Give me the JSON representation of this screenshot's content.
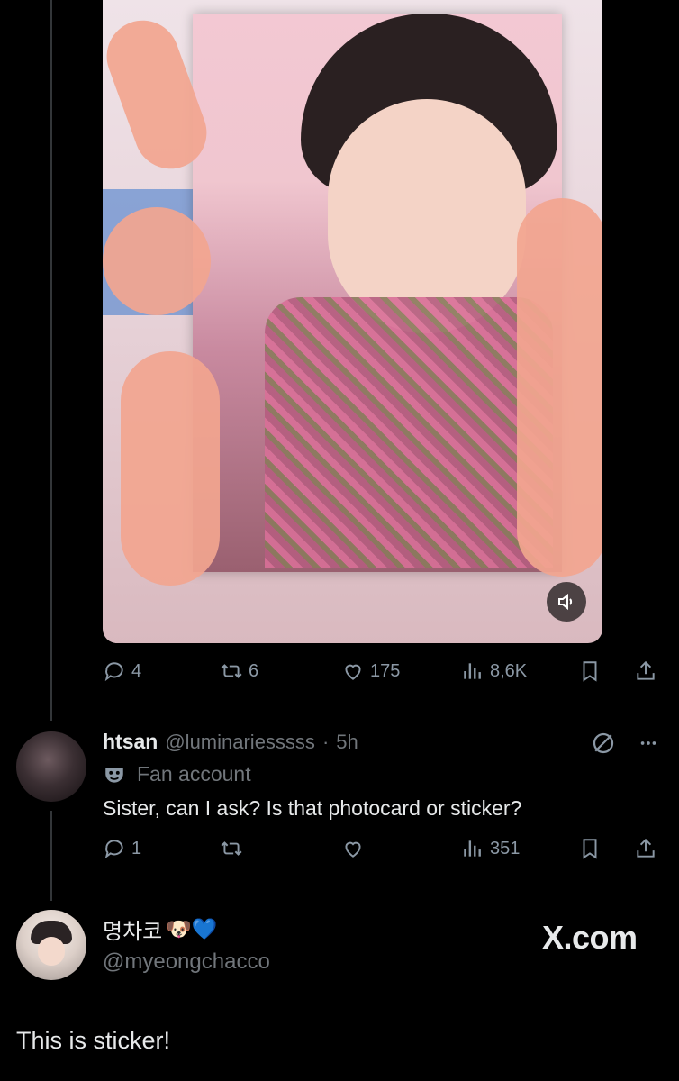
{
  "original_tweet": {
    "media": {
      "description_icon": "volume-icon"
    },
    "stats": {
      "replies": "4",
      "retweets": "6",
      "likes": "175",
      "views": "8,6K"
    }
  },
  "reply": {
    "name": "htsan",
    "handle": "@luminariesssss",
    "separator": "·",
    "time": "5h",
    "label_icon": "mask-icon",
    "label": "Fan account",
    "text": "Sister, can I ask? Is that photocard or sticker?",
    "stats": {
      "replies": "1",
      "views": "351"
    }
  },
  "author": {
    "name": "명차코",
    "emoji": "🐶💙",
    "handle": "@myeongchacco"
  },
  "watermark": "X.com",
  "main_text": "This is sticker!",
  "colors": {
    "background": "#000000",
    "muted": "#71767b",
    "text": "#e7e9ea",
    "thread_line": "#333639"
  }
}
